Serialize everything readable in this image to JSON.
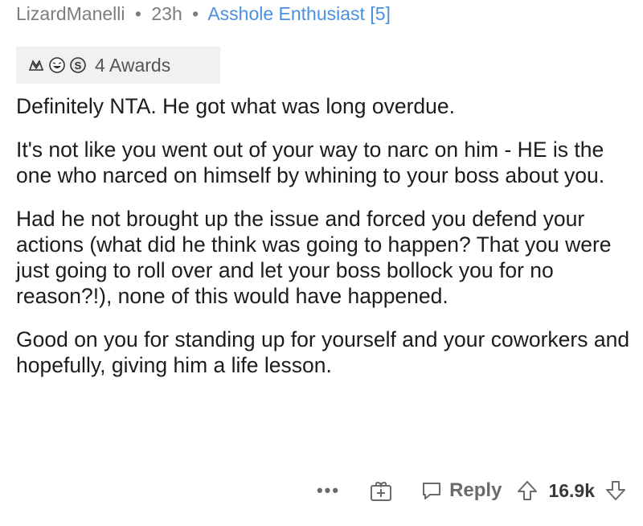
{
  "comment": {
    "author": "LizardManelli",
    "age": "23h",
    "flair": "Asshole Enthusiast [5]",
    "sep1": "•",
    "sep2": "•",
    "awards": {
      "icons": [
        "hands-clasped-award-icon",
        "laughing-face-award-icon",
        "silver-coin-award-icon"
      ],
      "label": "4 Awards"
    },
    "paragraphs": [
      "Definitely NTA. He got what was long overdue.",
      "It's not like you went out of your way to narc on him - HE is the one who narced on himself by whining to your boss about you.",
      "Had he not brought up the issue and forced you defend your actions (what did he think was going to happen? That you were just going to roll over and let your boss bollock you for no reason?!), none of this would have happened.",
      "Good on you for standing up for yourself and your coworkers and hopefully, giving him a life lesson."
    ]
  },
  "footer": {
    "more": "•••",
    "reply_label": "Reply",
    "score": "16.9k"
  },
  "colors": {
    "meta": "#7c7c7c",
    "flair": "#4a90e2",
    "text": "#1c1c1c",
    "award_bg": "#f1f1f1"
  }
}
